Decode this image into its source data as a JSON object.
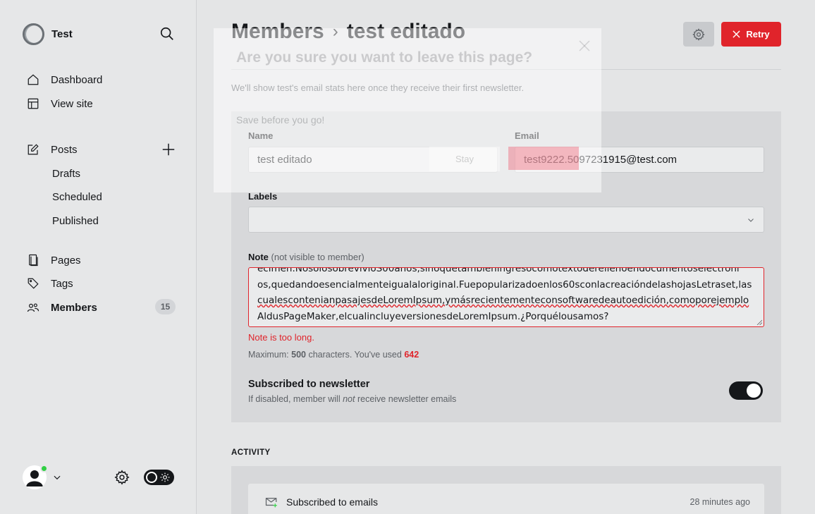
{
  "sidebar": {
    "brand_name": "Test",
    "nav": {
      "dashboard": "Dashboard",
      "view_site": "View site",
      "posts": "Posts",
      "drafts": "Drafts",
      "scheduled": "Scheduled",
      "published": "Published",
      "pages": "Pages",
      "tags": "Tags",
      "members": "Members",
      "members_count": "15"
    }
  },
  "header": {
    "breadcrumb_parent": "Members",
    "breadcrumb_separator": "›",
    "breadcrumb_current": "test editado",
    "retry_label": "Retry"
  },
  "member": {
    "email_stats_note": "We'll show test's email stats here once they receive their first newsletter.",
    "name_label": "Name",
    "name_value": "test editado",
    "email_label": "Email",
    "email_value": "test9222.5097231915@test.com",
    "labels_label": "Labels",
    "note_label": "Note",
    "note_hint": "(not visible to member)",
    "note_lines": [
      "ecimen.NosolosobrevivióS00años,sinoquetambiéningresócomotextoderellenoendocumentoselectróni",
      "os,quedandoesencialmenteigualaloriginal.Fuepopularizadoenlos60sconlacreacióndelashojasLetraset,las",
      "cualescontenianpasajesdeLoremIpsum,ymásrecientementeconsoftwaredeautoedición,comoporejemplo",
      "AldusPageMaker,elcualincluyeversionesdeLoremIpsum.¿Porquélousamos?"
    ],
    "note_error": "Note is too long.",
    "max_prefix": "Maximum:",
    "max_limit": "500",
    "max_mid": "characters. You've used",
    "max_used": "642",
    "newsletter_title": "Subscribed to newsletter",
    "newsletter_desc_pre": "If disabled, member will",
    "newsletter_desc_em": "not",
    "newsletter_desc_post": "receive newsletter emails"
  },
  "activity": {
    "title": "ACTIVITY",
    "items": [
      {
        "label": "Subscribed to emails",
        "time": "28 minutes ago",
        "icon": "mail-plus-icon"
      }
    ]
  },
  "modal": {
    "title": "Are you sure you want to leave this page?",
    "body": "Save before you go!",
    "stay_label": "Stay"
  },
  "colors": {
    "accent_red": "#e0242b",
    "online_green": "#30cf43",
    "text_dark": "#15171a"
  }
}
